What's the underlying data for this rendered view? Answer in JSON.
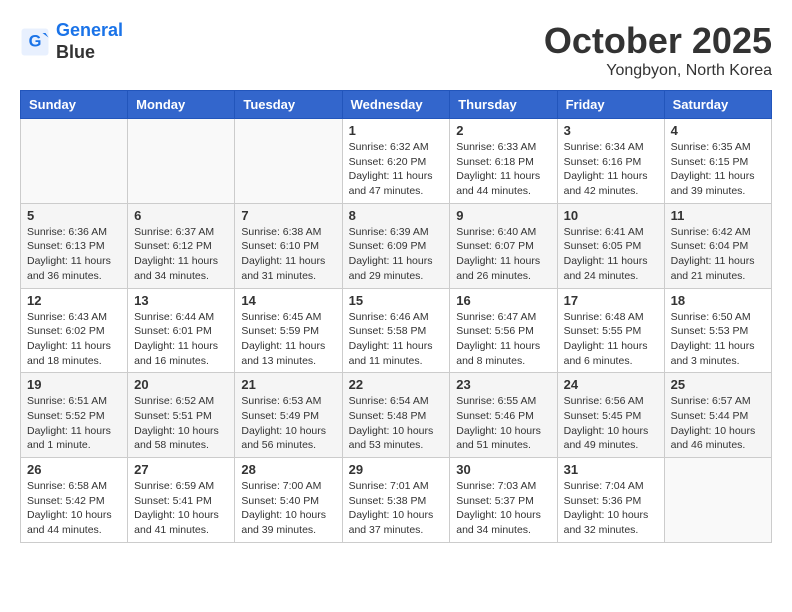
{
  "header": {
    "logo_line1": "General",
    "logo_line2": "Blue",
    "month_title": "October 2025",
    "location": "Yongbyon, North Korea"
  },
  "days_of_week": [
    "Sunday",
    "Monday",
    "Tuesday",
    "Wednesday",
    "Thursday",
    "Friday",
    "Saturday"
  ],
  "weeks": [
    [
      {
        "num": "",
        "info": ""
      },
      {
        "num": "",
        "info": ""
      },
      {
        "num": "",
        "info": ""
      },
      {
        "num": "1",
        "info": "Sunrise: 6:32 AM\nSunset: 6:20 PM\nDaylight: 11 hours and 47 minutes."
      },
      {
        "num": "2",
        "info": "Sunrise: 6:33 AM\nSunset: 6:18 PM\nDaylight: 11 hours and 44 minutes."
      },
      {
        "num": "3",
        "info": "Sunrise: 6:34 AM\nSunset: 6:16 PM\nDaylight: 11 hours and 42 minutes."
      },
      {
        "num": "4",
        "info": "Sunrise: 6:35 AM\nSunset: 6:15 PM\nDaylight: 11 hours and 39 minutes."
      }
    ],
    [
      {
        "num": "5",
        "info": "Sunrise: 6:36 AM\nSunset: 6:13 PM\nDaylight: 11 hours and 36 minutes."
      },
      {
        "num": "6",
        "info": "Sunrise: 6:37 AM\nSunset: 6:12 PM\nDaylight: 11 hours and 34 minutes."
      },
      {
        "num": "7",
        "info": "Sunrise: 6:38 AM\nSunset: 6:10 PM\nDaylight: 11 hours and 31 minutes."
      },
      {
        "num": "8",
        "info": "Sunrise: 6:39 AM\nSunset: 6:09 PM\nDaylight: 11 hours and 29 minutes."
      },
      {
        "num": "9",
        "info": "Sunrise: 6:40 AM\nSunset: 6:07 PM\nDaylight: 11 hours and 26 minutes."
      },
      {
        "num": "10",
        "info": "Sunrise: 6:41 AM\nSunset: 6:05 PM\nDaylight: 11 hours and 24 minutes."
      },
      {
        "num": "11",
        "info": "Sunrise: 6:42 AM\nSunset: 6:04 PM\nDaylight: 11 hours and 21 minutes."
      }
    ],
    [
      {
        "num": "12",
        "info": "Sunrise: 6:43 AM\nSunset: 6:02 PM\nDaylight: 11 hours and 18 minutes."
      },
      {
        "num": "13",
        "info": "Sunrise: 6:44 AM\nSunset: 6:01 PM\nDaylight: 11 hours and 16 minutes."
      },
      {
        "num": "14",
        "info": "Sunrise: 6:45 AM\nSunset: 5:59 PM\nDaylight: 11 hours and 13 minutes."
      },
      {
        "num": "15",
        "info": "Sunrise: 6:46 AM\nSunset: 5:58 PM\nDaylight: 11 hours and 11 minutes."
      },
      {
        "num": "16",
        "info": "Sunrise: 6:47 AM\nSunset: 5:56 PM\nDaylight: 11 hours and 8 minutes."
      },
      {
        "num": "17",
        "info": "Sunrise: 6:48 AM\nSunset: 5:55 PM\nDaylight: 11 hours and 6 minutes."
      },
      {
        "num": "18",
        "info": "Sunrise: 6:50 AM\nSunset: 5:53 PM\nDaylight: 11 hours and 3 minutes."
      }
    ],
    [
      {
        "num": "19",
        "info": "Sunrise: 6:51 AM\nSunset: 5:52 PM\nDaylight: 11 hours and 1 minute."
      },
      {
        "num": "20",
        "info": "Sunrise: 6:52 AM\nSunset: 5:51 PM\nDaylight: 10 hours and 58 minutes."
      },
      {
        "num": "21",
        "info": "Sunrise: 6:53 AM\nSunset: 5:49 PM\nDaylight: 10 hours and 56 minutes."
      },
      {
        "num": "22",
        "info": "Sunrise: 6:54 AM\nSunset: 5:48 PM\nDaylight: 10 hours and 53 minutes."
      },
      {
        "num": "23",
        "info": "Sunrise: 6:55 AM\nSunset: 5:46 PM\nDaylight: 10 hours and 51 minutes."
      },
      {
        "num": "24",
        "info": "Sunrise: 6:56 AM\nSunset: 5:45 PM\nDaylight: 10 hours and 49 minutes."
      },
      {
        "num": "25",
        "info": "Sunrise: 6:57 AM\nSunset: 5:44 PM\nDaylight: 10 hours and 46 minutes."
      }
    ],
    [
      {
        "num": "26",
        "info": "Sunrise: 6:58 AM\nSunset: 5:42 PM\nDaylight: 10 hours and 44 minutes."
      },
      {
        "num": "27",
        "info": "Sunrise: 6:59 AM\nSunset: 5:41 PM\nDaylight: 10 hours and 41 minutes."
      },
      {
        "num": "28",
        "info": "Sunrise: 7:00 AM\nSunset: 5:40 PM\nDaylight: 10 hours and 39 minutes."
      },
      {
        "num": "29",
        "info": "Sunrise: 7:01 AM\nSunset: 5:38 PM\nDaylight: 10 hours and 37 minutes."
      },
      {
        "num": "30",
        "info": "Sunrise: 7:03 AM\nSunset: 5:37 PM\nDaylight: 10 hours and 34 minutes."
      },
      {
        "num": "31",
        "info": "Sunrise: 7:04 AM\nSunset: 5:36 PM\nDaylight: 10 hours and 32 minutes."
      },
      {
        "num": "",
        "info": ""
      }
    ]
  ]
}
